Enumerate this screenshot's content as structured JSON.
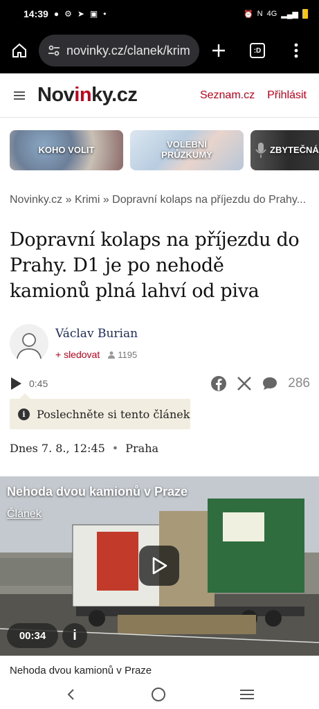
{
  "status_bar": {
    "time": "14:39",
    "network": "4G"
  },
  "browser": {
    "url": "novinky.cz/clanek/krim",
    "tab_label": ":D"
  },
  "site": {
    "logo_prefix": "Nov",
    "logo_highlight": "in",
    "logo_suffix": "ky.cz",
    "seznam_link": "Seznam.cz",
    "login_link": "Přihlásit",
    "accent_color": "#c4001a"
  },
  "tiles": [
    {
      "label": "KOHO VOLIT"
    },
    {
      "label": "VOLEBNÍ PRŮZKUMY"
    },
    {
      "label": "ZBYTEČNÁ"
    }
  ],
  "breadcrumb": "Novinky.cz » Krimi » Dopravní kolaps na příjezdu do Prahy...",
  "article": {
    "headline": "Dopravní kolaps na příjezdu do Prahy. D1 je po nehodě kamionů plná lahví od piva",
    "author_name": "Václav Burian",
    "follow_label": "+ sledovat",
    "followers": "1195",
    "audio_duration": "0:45",
    "comments_count": "286",
    "listen_label": "Poslechněte si tento článek",
    "date": "Dnes 7. 8., 12:45",
    "location": "Praha"
  },
  "video": {
    "title": "Nehoda dvou kamionů v Praze",
    "link_label": "Článek",
    "time": "00:34",
    "info_label": "i",
    "caption": "Nehoda dvou kamionů v Praze"
  }
}
